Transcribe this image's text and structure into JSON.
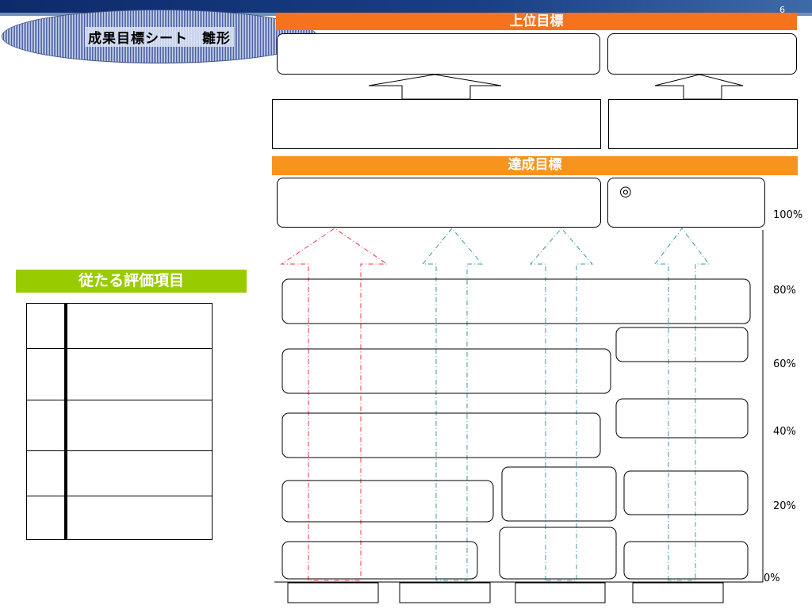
{
  "header": {
    "title": "成果目標シート　雛形",
    "slide_number": "6"
  },
  "bands": {
    "upper_goal": "上位目標",
    "achievement_goal": "達成目標"
  },
  "achievement_box": {
    "symbol": "◎"
  },
  "side_table": {
    "title": "従たる評価項目",
    "rows": 5
  },
  "scale": {
    "labels": [
      "100%",
      "80%",
      "60%",
      "40%",
      "20%",
      "0%"
    ]
  },
  "colors": {
    "orange_upper": "#f5731c",
    "orange_achieve": "#f7941d",
    "green": "#99cc00",
    "red_arrow": "#e8373b",
    "teal_arrow": "#3c9aa8"
  }
}
